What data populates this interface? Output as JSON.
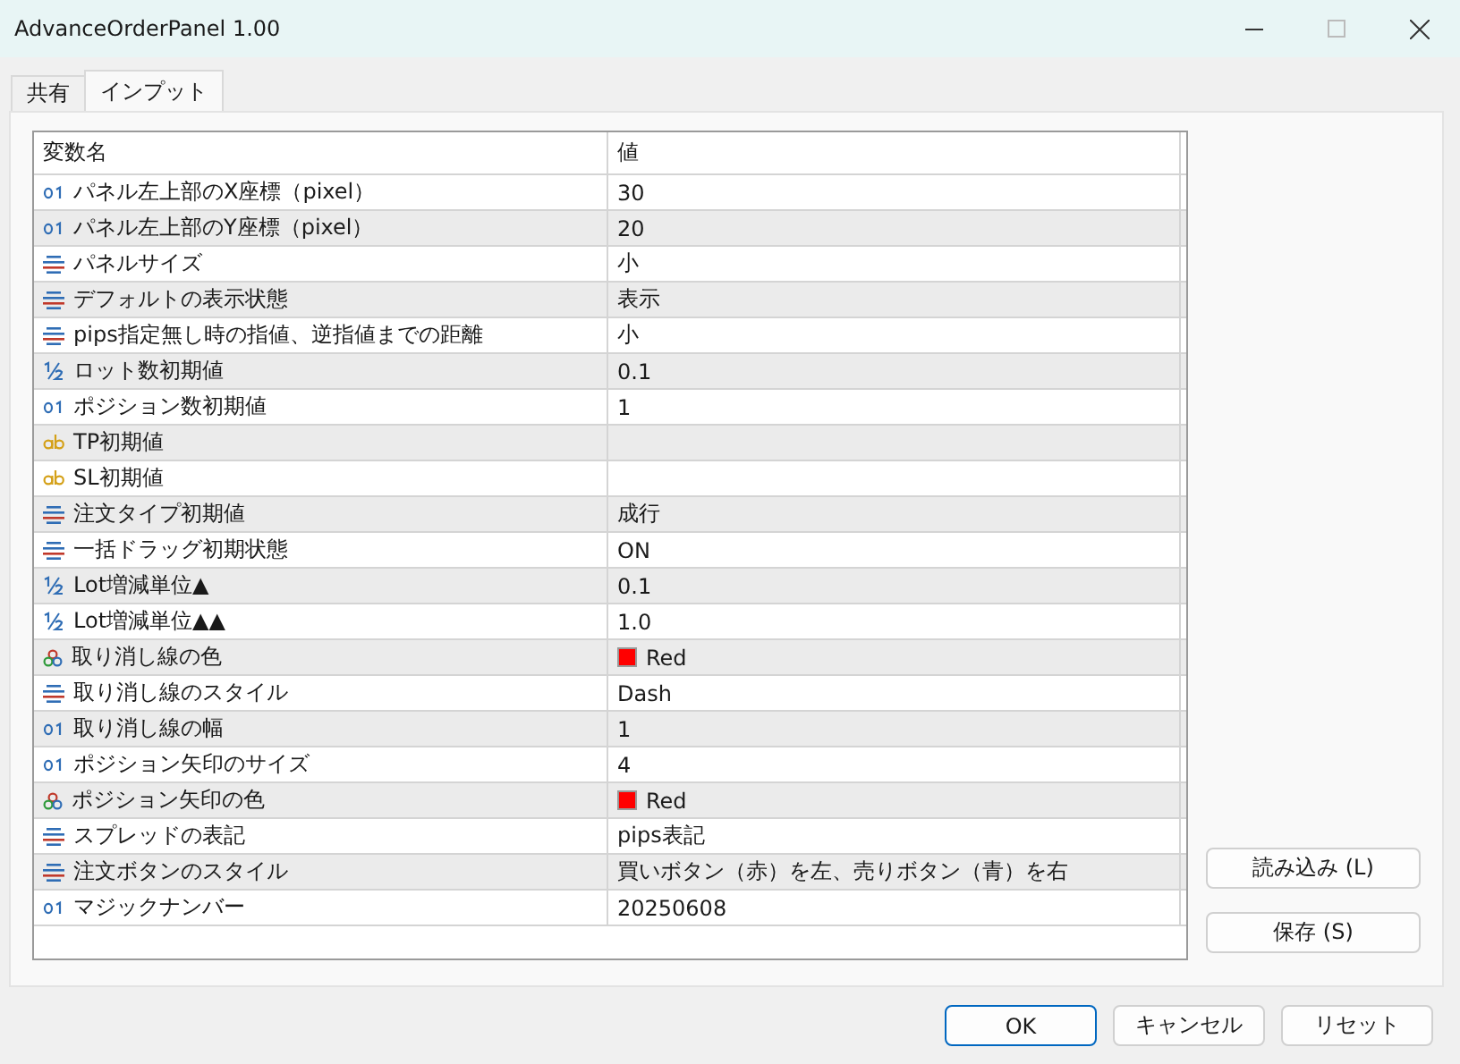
{
  "window": {
    "title": "AdvanceOrderPanel 1.00"
  },
  "tabs": [
    {
      "label": "共有",
      "selected": false
    },
    {
      "label": "インプット",
      "selected": true
    }
  ],
  "table": {
    "columns": [
      "変数名",
      "値"
    ],
    "rows": [
      {
        "kind": "int",
        "name": "パネル左上部のX座標（pixel）",
        "value": "30"
      },
      {
        "kind": "int",
        "name": "パネル左上部のY座標（pixel）",
        "value": "20"
      },
      {
        "kind": "enum",
        "name": "パネルサイズ",
        "value": "小"
      },
      {
        "kind": "enum",
        "name": "デフォルトの表示状態",
        "value": "表示"
      },
      {
        "kind": "enum",
        "name": "pips指定無し時の指値、逆指値までの距離",
        "value": "小"
      },
      {
        "kind": "double",
        "name": "ロット数初期値",
        "value": "0.1"
      },
      {
        "kind": "int",
        "name": "ポジション数初期値",
        "value": "1"
      },
      {
        "kind": "string",
        "name": "TP初期値"
      },
      {
        "kind": "string",
        "name": "SL初期値"
      },
      {
        "kind": "enum",
        "name": "注文タイプ初期値",
        "value": "成行"
      },
      {
        "kind": "enum",
        "name": "一括ドラッグ初期状態",
        "value": "ON"
      },
      {
        "kind": "double",
        "name": "Lot増減単位▲",
        "value": "0.1"
      },
      {
        "kind": "double",
        "name": "Lot増減単位▲▲",
        "value": "1.0"
      },
      {
        "kind": "color",
        "name": "取り消し線の色",
        "value": "Red",
        "color": "#ff0000"
      },
      {
        "kind": "enum",
        "name": "取り消し線のスタイル",
        "value": "Dash"
      },
      {
        "kind": "int",
        "name": "取り消し線の幅",
        "value": "1"
      },
      {
        "kind": "int",
        "name": "ポジション矢印のサイズ",
        "value": "4"
      },
      {
        "kind": "color",
        "name": "ポジション矢印の色",
        "value": "Red",
        "color": "#ff0000"
      },
      {
        "kind": "enum",
        "name": "スプレッドの表記",
        "value": "pips表記"
      },
      {
        "kind": "enum",
        "name": "注文ボタンのスタイル",
        "value": "買いボタン（赤）を左、売りボタン（青）を右"
      },
      {
        "kind": "int",
        "name": "マジックナンバー",
        "value": "20250608"
      }
    ]
  },
  "side_buttons": [
    "読み込み (L)",
    "保存 (S)"
  ],
  "footer_buttons": [
    {
      "label": "OK",
      "default": true
    },
    {
      "label": "キャンセル",
      "default": false
    },
    {
      "label": "リセット",
      "default": false
    }
  ]
}
